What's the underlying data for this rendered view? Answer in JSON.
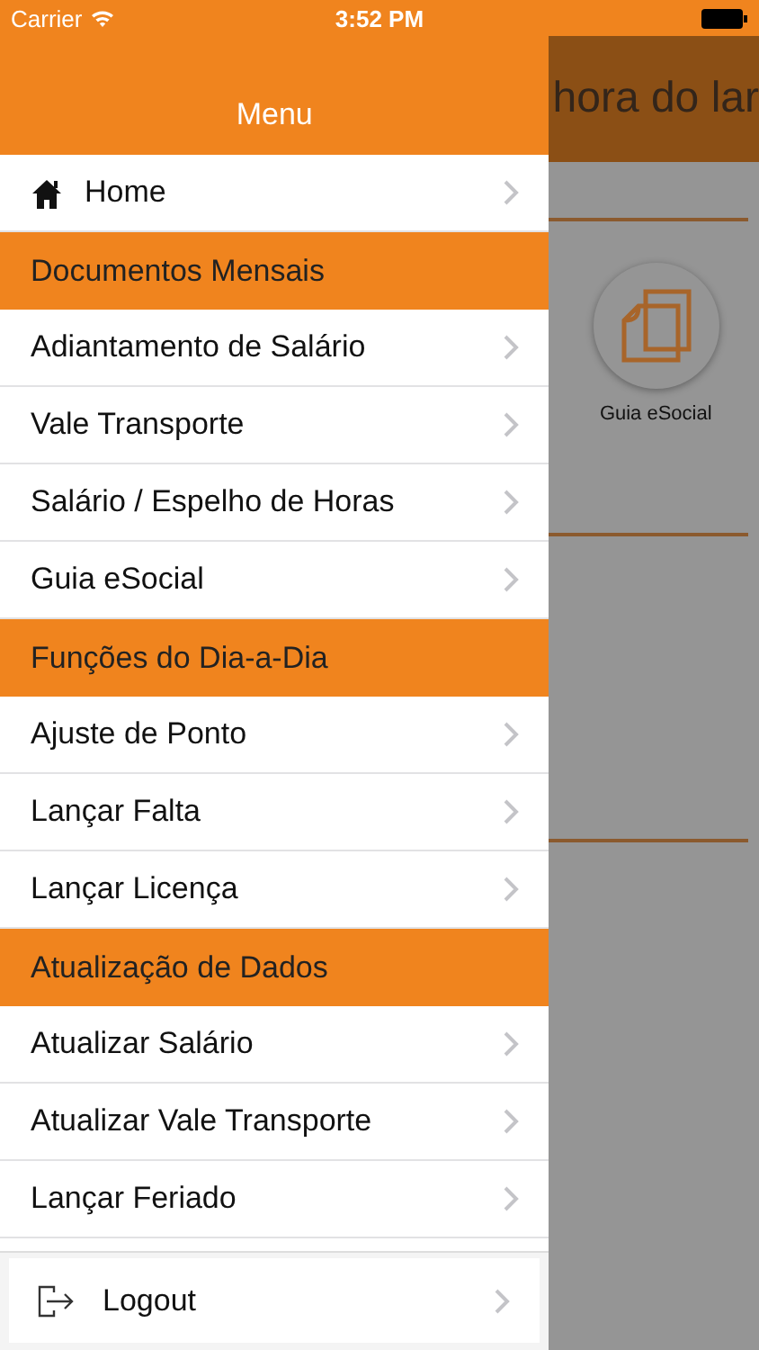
{
  "status_bar": {
    "carrier": "Carrier",
    "time": "3:52 PM"
  },
  "menu": {
    "title": "Menu",
    "items": [
      {
        "kind": "home",
        "label": "Home"
      },
      {
        "kind": "section",
        "label": "Documentos Mensais"
      },
      {
        "kind": "link",
        "label": "Adiantamento de Salário"
      },
      {
        "kind": "link",
        "label": "Vale Transporte"
      },
      {
        "kind": "link",
        "label": "Salário / Espelho de Horas"
      },
      {
        "kind": "link",
        "label": "Guia eSocial"
      },
      {
        "kind": "section",
        "label": "Funções do Dia-a-Dia"
      },
      {
        "kind": "link",
        "label": "Ajuste de Ponto"
      },
      {
        "kind": "link",
        "label": "Lançar Falta"
      },
      {
        "kind": "link",
        "label": "Lançar Licença"
      },
      {
        "kind": "section",
        "label": "Atualização de Dados"
      },
      {
        "kind": "link",
        "label": "Atualizar Salário"
      },
      {
        "kind": "link",
        "label": "Atualizar Vale Transporte"
      },
      {
        "kind": "link",
        "label": "Lançar Feriado"
      }
    ],
    "logout": {
      "label": "Logout"
    }
  },
  "background": {
    "title": "hora do lar",
    "tile_label": "Guia eSocial"
  }
}
